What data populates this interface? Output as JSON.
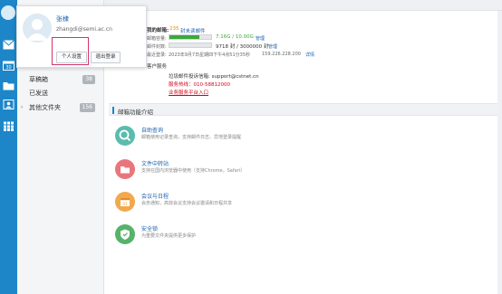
{
  "popup": {
    "name": "张棣",
    "email": "zhangdi@semi.ac.cn",
    "profile_button": "个人设置",
    "logout_button": "退出登录"
  },
  "folders": [
    {
      "label": "草稿箱",
      "count": "38"
    },
    {
      "label": "已发送",
      "count": ""
    },
    {
      "label": "其他文件夹",
      "count": "156"
    }
  ],
  "mailbox": {
    "title": "我的邮箱:",
    "unread_count": "235",
    "unread_suffix": "封未读邮件",
    "capacity_label": "邮箱容量:",
    "capacity_value": "7.16G / 10.00G",
    "capacity_manage": "管理",
    "capacity_used_fraction": 0.716,
    "count_label": "邮件封数:",
    "count_value": "9718 封 / 3000000 封",
    "count_manage": "管理",
    "login_label": "最近登录:",
    "login_value": "2023年9月7日星期四下午4点51分35秒",
    "login_ip": "159.226.228.200",
    "login_detail": "详情"
  },
  "support": {
    "title": "客户服务",
    "email_line": "垃圾邮件投诉信箱: support@cstnet.cn",
    "hotline": "服务热线：010-58812000",
    "platform": "业务服务平台入口"
  },
  "features": {
    "section_title": "邮箱功能介绍",
    "items": [
      {
        "title": "自助查询",
        "desc": "邮箱使用记录查询，支持邮件日志、异地登录提醒",
        "color": "#5bbcae"
      },
      {
        "title": "文件中转站",
        "desc": "支持在国内浏览器中使用（支持Chrome，Safari）",
        "color": "#e9767d"
      },
      {
        "title": "会议与日程",
        "desc": "会务通知，高效会议支持会议邀请和日程共享",
        "color": "#f1a94e"
      },
      {
        "title": "安全锁",
        "desc": "为重要文件夹提供更多保护",
        "color": "#57b26a"
      }
    ]
  },
  "colors": {
    "sidebar_blue": "#1c86c8",
    "link_blue": "#1b62b0",
    "support_red": "#d0021b",
    "highlight": "#d2356e",
    "progress_green": "#3aa838"
  }
}
